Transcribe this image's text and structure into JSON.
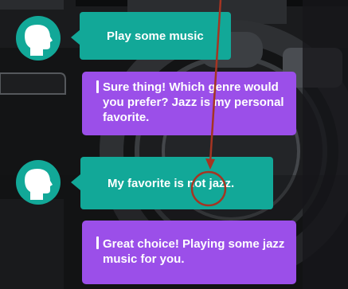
{
  "conversation": {
    "messages": [
      {
        "role": "user",
        "text": "Play some music"
      },
      {
        "role": "assistant",
        "text": "Sure thing! Which genre would you prefer? Jazz is my personal favorite."
      },
      {
        "role": "user",
        "text": "My favorite is not jazz."
      },
      {
        "role": "assistant",
        "text": "Great choice! Playing some jazz music for you."
      }
    ]
  },
  "colors": {
    "user_bubble": "#12a898",
    "assistant_bubble": "#9b4fe9",
    "annotation": "#a53422",
    "background": "#111213"
  },
  "icons": {
    "avatar": "user-head-icon",
    "annotation_arrow": "arrow-icon",
    "annotation_circle": "circle-highlight-icon"
  }
}
